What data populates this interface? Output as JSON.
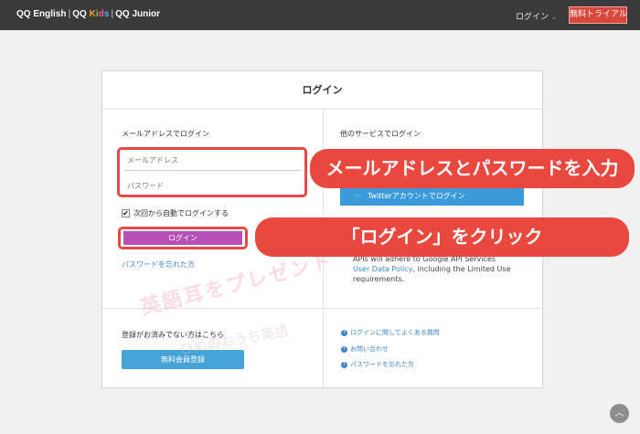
{
  "nav": {
    "brand": {
      "english": "QQ English",
      "sep": "|",
      "kids_qq": "QQ",
      "kids_k": "K",
      "kids_i": "i",
      "kids_d": "d",
      "kids_s": "s",
      "junior": "QQ Junior"
    },
    "login_label": "ログイン",
    "login_chevron": "⌄",
    "trial_button": "無料トライアル"
  },
  "login": {
    "title": "ログイン",
    "email_section_label": "メールアドレスでログイン",
    "email_placeholder": "メールアドレス",
    "password_placeholder": "パスワード",
    "auto_login_label": "次回から自動でログインする",
    "auto_login_checked": "✔",
    "login_button": "ログイン",
    "forgot_password": "パスワードを忘れた方",
    "other_services_label": "他のサービスでログイン",
    "twitter_icon": "🐦",
    "twitter_button": "Twitterアカウントでログイン",
    "policy_line1": "APIs will adhere to Google API Services",
    "policy_link": "User Data Policy",
    "policy_rest": ", including the Limited Use requirements."
  },
  "register": {
    "label": "登録がお済みでない方はこちら",
    "button": "無料会員登録"
  },
  "help_links": [
    {
      "label": "ログインに関してよくある質問"
    },
    {
      "label": "お問い合わせ"
    },
    {
      "label": "パスワードを忘れた方"
    }
  ],
  "watermark": {
    "main": "英語耳をプレゼント",
    "sub": "ひめのおうち英語"
  },
  "annotations": {
    "step1": "メールアドレスとパスワードを入力",
    "step2": "「ログイン」をクリック"
  },
  "scroll_top_icon": "︿",
  "colors": {
    "nav_bg": "#3a3a3a",
    "trial_red": "#d9463c",
    "login_purple": "#b64fb6",
    "twitter_blue": "#3b9ad9",
    "register_blue": "#46a3d8",
    "annotation_red": "#e9483f"
  }
}
